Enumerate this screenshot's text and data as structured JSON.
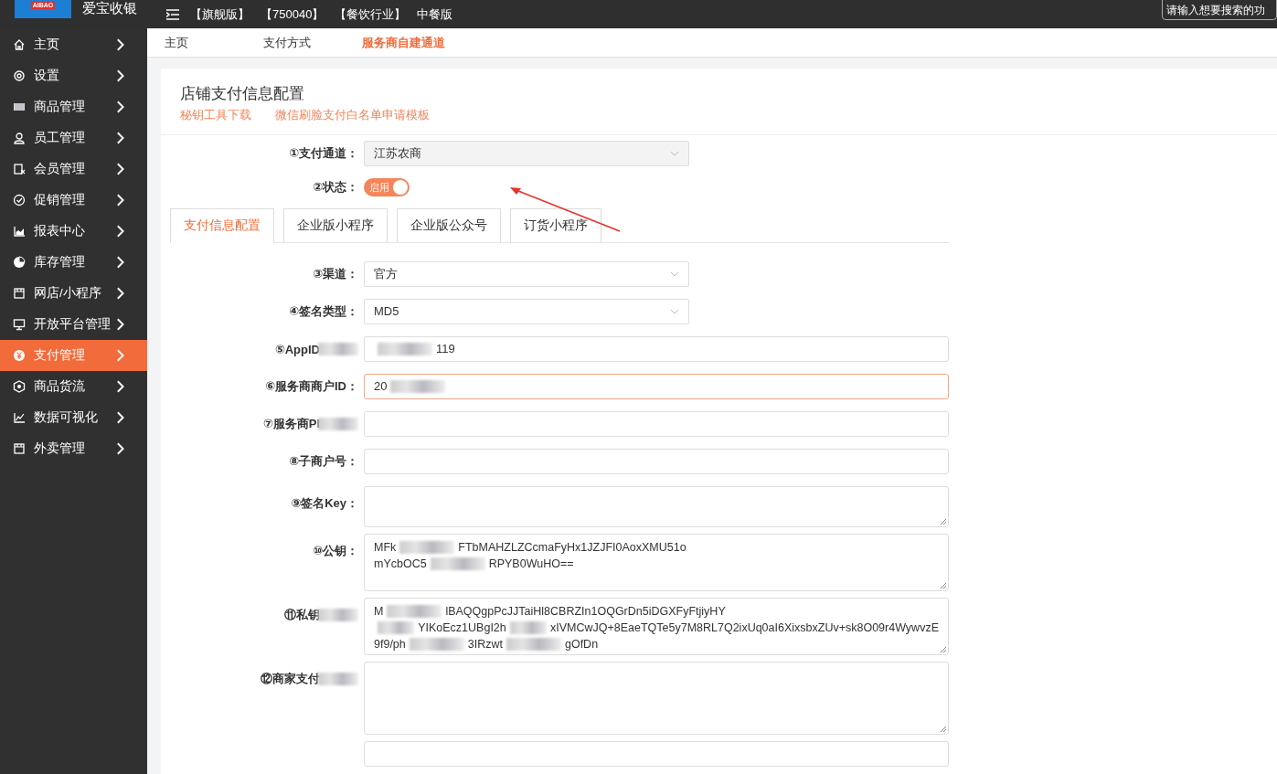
{
  "topbar": {
    "brand": "爱宝收银",
    "logo_text": "AIBAO",
    "tags": [
      "【旗舰版】",
      "【750040】",
      "【餐饮行业】",
      "中餐版"
    ],
    "search": {
      "placeholder": "请输入想要搜索的功"
    }
  },
  "sidebar": {
    "items": [
      {
        "label": "主页",
        "selected": false
      },
      {
        "label": "设置",
        "selected": false
      },
      {
        "label": "商品管理",
        "selected": false
      },
      {
        "label": "员工管理",
        "selected": false
      },
      {
        "label": "会员管理",
        "selected": false
      },
      {
        "label": "促销管理",
        "selected": false
      },
      {
        "label": "报表中心",
        "selected": false
      },
      {
        "label": "库存管理",
        "selected": false
      },
      {
        "label": "网店/小程序",
        "selected": false
      },
      {
        "label": "开放平台管理",
        "selected": false
      },
      {
        "label": "支付管理",
        "selected": true
      },
      {
        "label": "商品货流",
        "selected": false
      },
      {
        "label": "数据可视化",
        "selected": false
      },
      {
        "label": "外卖管理",
        "selected": false
      }
    ]
  },
  "breadcrumb": [
    {
      "label": "主页",
      "selected": false
    },
    {
      "label": "支付方式",
      "selected": false
    },
    {
      "label": "服务商自建通道",
      "selected": true
    }
  ],
  "card": {
    "title": "店铺支付信息配置",
    "links": [
      "秘钥工具下载",
      "微信刷脸支付白名单申请模板"
    ],
    "top_fields": [
      {
        "kind": "select",
        "label": "①支付通道：",
        "value": "江苏农商"
      },
      {
        "kind": "toggle",
        "label": "②状态：",
        "on": true,
        "text": "启用"
      }
    ],
    "tabs": [
      {
        "label": "支付信息配置",
        "selected": true
      },
      {
        "label": "企业版小程序",
        "selected": false
      },
      {
        "label": "企业版公众号",
        "selected": false
      },
      {
        "label": "订货小程序",
        "selected": false
      }
    ],
    "fields": [
      {
        "kind": "select",
        "label": "③渠道：",
        "lines": [
          [
            {
              "kind": "text",
              "text": "官方"
            }
          ]
        ]
      },
      {
        "kind": "select",
        "label": "④签名类型：",
        "lines": [
          [
            {
              "kind": "text",
              "text": "MD5"
            }
          ]
        ]
      },
      {
        "kind": "input",
        "label": "⑤AppID",
        "label_blurred": true,
        "focused": false,
        "lines": [
          [
            {
              "kind": "blur"
            },
            {
              "kind": "text",
              "text": "119"
            }
          ]
        ]
      },
      {
        "kind": "input",
        "label": "⑥服务商商户ID：",
        "focused": true,
        "lines": [
          [
            {
              "kind": "text",
              "text": "20"
            },
            {
              "kind": "blur"
            }
          ]
        ]
      },
      {
        "kind": "input",
        "label": "⑦服务商PI",
        "label_blurred": true,
        "focused": false
      },
      {
        "kind": "input",
        "label": "⑧子商户号：",
        "focused": false
      },
      {
        "kind": "textarea",
        "label": "⑨签名Key："
      },
      {
        "kind": "textarea",
        "label": "⑩公钥：",
        "lines": [
          [
            {
              "kind": "text",
              "text": "MFk"
            },
            {
              "kind": "blur"
            },
            {
              "kind": "text",
              "text": "FTbMAHZLZCcmaFyHx1JZJFI0AoxXMU51o"
            }
          ],
          [
            {
              "kind": "text",
              "text": "mYcbOC5"
            },
            {
              "kind": "blur"
            },
            {
              "kind": "text",
              "text": "RPYB0WuHO=="
            }
          ]
        ]
      },
      {
        "kind": "textarea",
        "label": "⑪私钥",
        "label_blurred": true,
        "lines": [
          [
            {
              "kind": "text",
              "text": "M"
            },
            {
              "kind": "blur"
            },
            {
              "kind": "text",
              "text": "lBAQQgpPcJJTaiHl8CBRZIn1OQGrDn5iDGXFyFtjiyHY"
            }
          ],
          [
            {
              "kind": "blur"
            },
            {
              "kind": "text",
              "text": "YIKoEcz1UBgI2h"
            },
            {
              "kind": "blur"
            },
            {
              "kind": "text",
              "text": "xIVMCwJQ+8EaeTQTe5y7M8RL7Q2ixUq0aI6XixsbxZUv+sk8O09r4WywvzE"
            }
          ],
          [
            {
              "kind": "text",
              "text": "9f9/ph"
            },
            {
              "kind": "blur"
            },
            {
              "kind": "text",
              "text": "3IRzwt"
            },
            {
              "kind": "blur"
            },
            {
              "kind": "text",
              "text": "gOfDn"
            }
          ]
        ]
      },
      {
        "kind": "textarea",
        "label": "⑫商家支付",
        "label_blurred": true
      },
      {
        "kind": "input"
      }
    ]
  }
}
